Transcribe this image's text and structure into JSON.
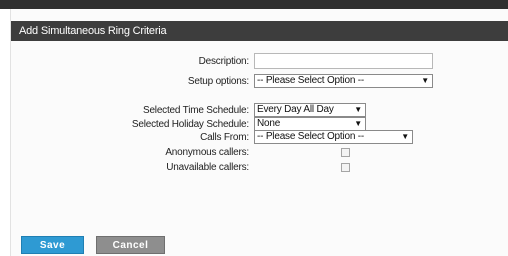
{
  "dialog": {
    "title": "Add Simultaneous Ring Criteria"
  },
  "form": {
    "description_label": "Description:",
    "description_value": "",
    "setup_label": "Setup options:",
    "setup_value": "-- Please Select Option --",
    "time_schedule_label": "Selected Time Schedule:",
    "time_schedule_value": "Every Day All Day",
    "holiday_schedule_label": "Selected Holiday Schedule:",
    "holiday_schedule_value": "None",
    "calls_from_label": "Calls From:",
    "calls_from_value": "-- Please Select Option --",
    "anonymous_label": "Anonymous callers:",
    "anonymous_checked": false,
    "unavailable_label": "Unavailable callers:",
    "unavailable_checked": false
  },
  "buttons": {
    "save": "Save",
    "cancel": "Cancel"
  },
  "icons": {
    "dropdown": "chevron-down-icon"
  },
  "colors": {
    "header_bg": "#3d3d3d",
    "save_bg": "#2e9ad3",
    "cancel_bg": "#8e8e8e"
  }
}
